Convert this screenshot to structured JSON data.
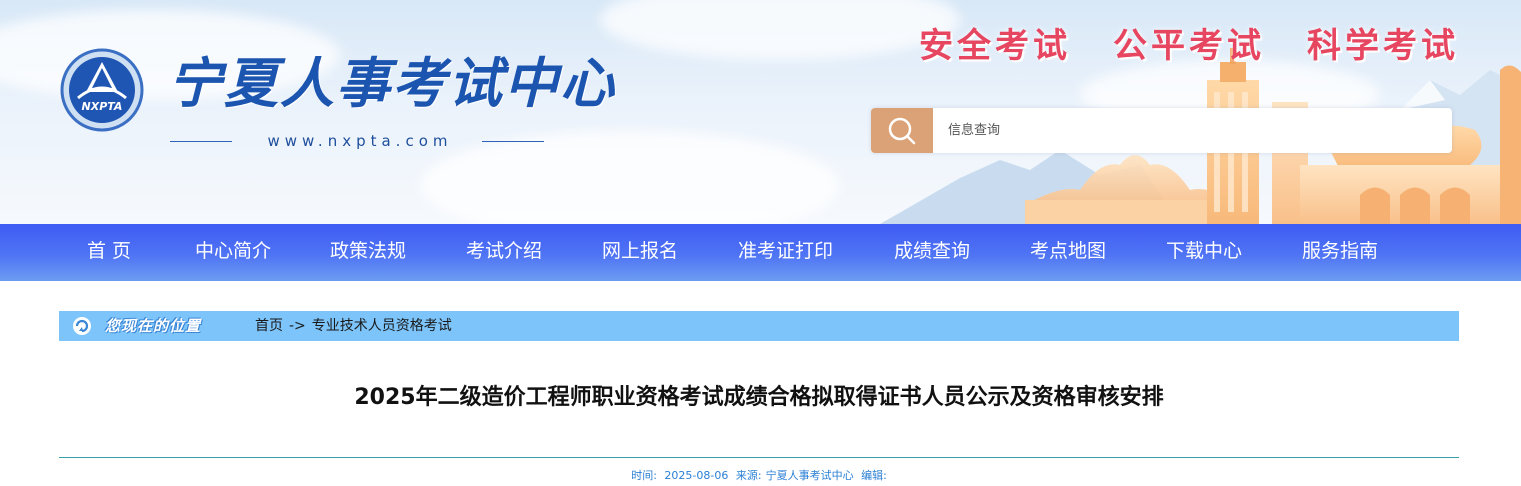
{
  "header": {
    "site_title": "宁夏人事考试中心",
    "site_url": "www.nxpta.com",
    "logo_text": "NXPTA",
    "slogans": [
      "安全考试",
      "公平考试",
      "科学考试"
    ],
    "search": {
      "placeholder": "信息查询",
      "icon": "search-icon"
    }
  },
  "nav": {
    "items": [
      {
        "label": "首 页"
      },
      {
        "label": "中心简介"
      },
      {
        "label": "政策法规"
      },
      {
        "label": "考试介绍"
      },
      {
        "label": "网上报名"
      },
      {
        "label": "准考证打印"
      },
      {
        "label": "成绩查询"
      },
      {
        "label": "考点地图"
      },
      {
        "label": "下载中心"
      },
      {
        "label": "服务指南"
      }
    ]
  },
  "breadcrumb": {
    "label": "您现在的位置",
    "separator": "->",
    "items": [
      "首页",
      "专业技术人员资格考试"
    ]
  },
  "article": {
    "title": "2025年二级造价工程师职业资格考试成绩合格拟取得证书人员公示及资格审核安排",
    "meta": {
      "time_label": "时间:",
      "time": "2025-08-06",
      "source_label": "来源:",
      "source": "宁夏人事考试中心",
      "editor_label": "编辑:"
    }
  },
  "colors": {
    "nav_start": "#3f5cf4",
    "nav_end": "#6c9cf2",
    "slogan": "#e64660",
    "search_button": "#dba277",
    "breadcrumb_bar": "#7cc4fa",
    "meta_text": "#2a7fd4",
    "divider": "#3aa0a8"
  }
}
